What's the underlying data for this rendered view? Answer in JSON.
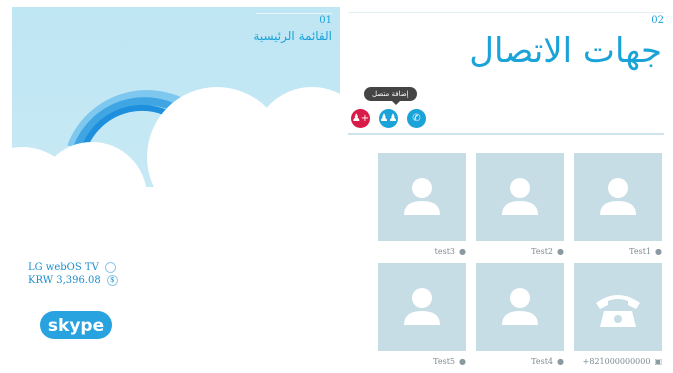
{
  "left_panel": {
    "number": "01",
    "menu_label": "القائمة الرئيسية",
    "device_name": "LG webOS TV",
    "balance": "KRW 3,396.08",
    "logo_text": "skype"
  },
  "right_panel": {
    "number": "02",
    "title": "جهات الاتصال",
    "tooltip": "إضافة متصل",
    "buttons": {
      "add_contact": "add-person-icon",
      "group": "group-icon",
      "call": "phone-icon"
    }
  },
  "contacts": [
    {
      "name": "Test1",
      "type": "person"
    },
    {
      "name": "Test2",
      "type": "person"
    },
    {
      "name": "test3",
      "type": "person"
    },
    {
      "name": "+821000000000",
      "type": "phone"
    },
    {
      "name": "Test4",
      "type": "person"
    },
    {
      "name": "Test5",
      "type": "person"
    }
  ],
  "colors": {
    "accent": "#1aa3d9",
    "add_button": "#d81b49",
    "card": "#c6dde5",
    "sky": "#c7e9f5"
  }
}
